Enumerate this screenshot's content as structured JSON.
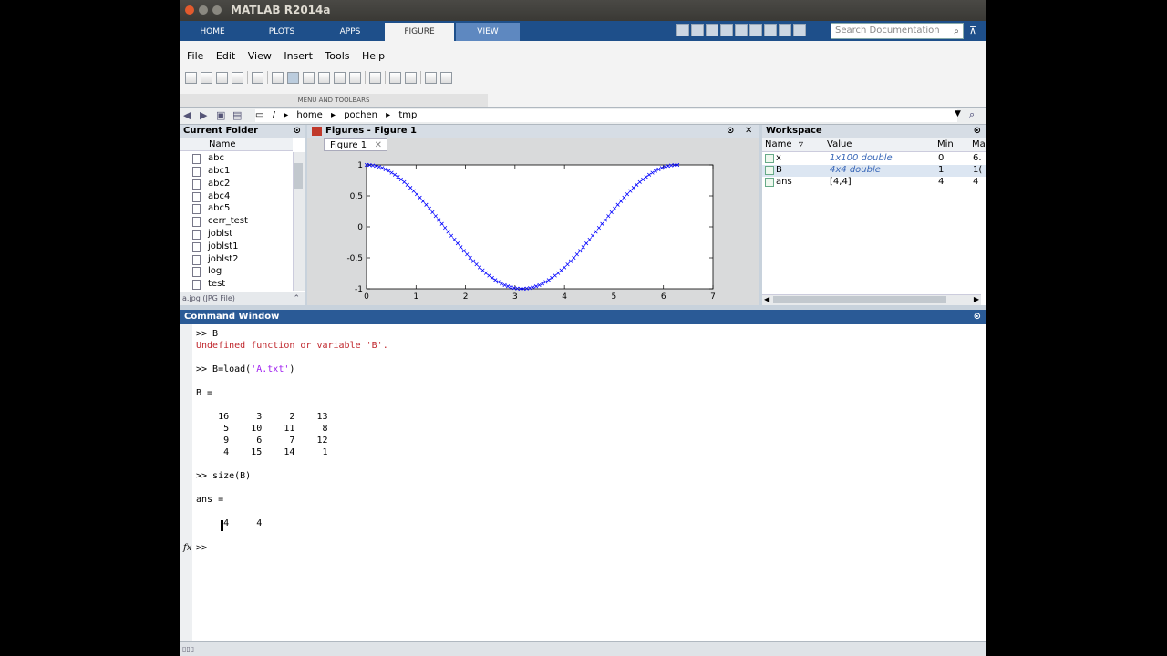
{
  "window": {
    "title": "MATLAB R2014a"
  },
  "ribbon_tabs": [
    "HOME",
    "PLOTS",
    "APPS",
    "FIGURE",
    "VIEW"
  ],
  "search": {
    "placeholder": "Search Documentation"
  },
  "figure_menu": [
    "File",
    "Edit",
    "View",
    "Insert",
    "Tools",
    "Help"
  ],
  "ribbon_section_label": "MENU AND TOOLBARS",
  "address": {
    "path": [
      "/",
      "home",
      "pochen",
      "tmp"
    ]
  },
  "current_folder": {
    "title": "Current Folder",
    "column": "Name",
    "items": [
      "abc",
      "abc1",
      "abc2",
      "abc4",
      "abc5",
      "cerr_test",
      "joblst",
      "joblst1",
      "joblst2",
      "log",
      "test"
    ],
    "status": "a.jpg (JPG File)"
  },
  "figures": {
    "title": "Figures - Figure 1",
    "tab": "Figure 1"
  },
  "chart_data": {
    "type": "line",
    "marker": "x",
    "color": "#0000ff",
    "series": [
      {
        "function": "cos(x)",
        "x_range": [
          0,
          6.2832
        ],
        "points": 100
      }
    ],
    "x_ticks": [
      "0",
      "1",
      "2",
      "3",
      "4",
      "5",
      "6",
      "7"
    ],
    "y_ticks": [
      "1",
      "0.5",
      "0",
      "-0.5",
      "-1"
    ],
    "xlim": [
      0,
      7
    ],
    "ylim": [
      -1,
      1
    ],
    "grid": false
  },
  "workspace": {
    "title": "Workspace",
    "columns": [
      "Name",
      "Value",
      "Min",
      "Ma"
    ],
    "rows": [
      {
        "name": "x",
        "value": "1x100 double",
        "min": "0",
        "max": "6."
      },
      {
        "name": "B",
        "value": "4x4 double",
        "min": "1",
        "max": "1("
      },
      {
        "name": "ans",
        "value": "[4,4]",
        "min": "4",
        "max": "4"
      }
    ]
  },
  "command_window": {
    "title": "Command Window",
    "lines": {
      "l1": ">> B",
      "l2": "Undefined function or variable 'B'.",
      "l3a": ">> B=load(",
      "l3b": "'A.txt'",
      "l3c": ")",
      "l4": "B =",
      "m1": "    16     3     2    13",
      "m2": "     5    10    11     8",
      "m3": "     9     6     7    12",
      "m4": "     4    15    14     1",
      "l5": ">> size(B)",
      "l6": "ans =",
      "l7": "     4     4"
    },
    "fx": "fx",
    "prompt": ">>"
  }
}
